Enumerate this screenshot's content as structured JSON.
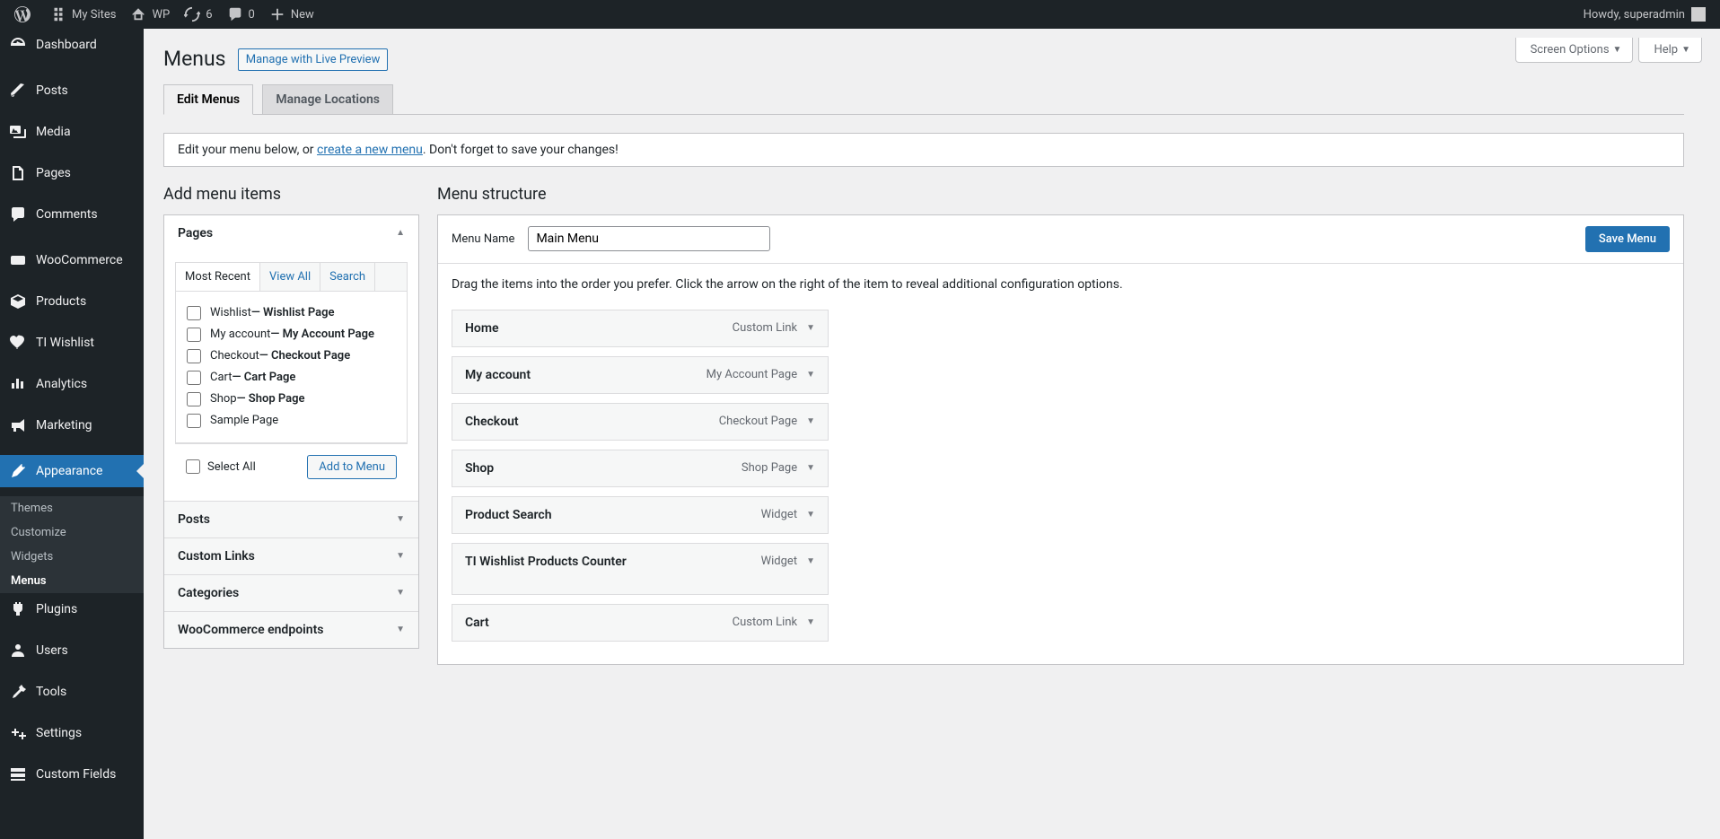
{
  "adminbar": {
    "mysites": "My Sites",
    "sitename": "WP",
    "updates": "6",
    "comments": "0",
    "new": "New",
    "howdy": "Howdy, superadmin"
  },
  "sidebar": {
    "items": [
      {
        "label": "Dashboard",
        "icon": "dashboard"
      },
      {
        "label": "Posts",
        "icon": "posts"
      },
      {
        "label": "Media",
        "icon": "media"
      },
      {
        "label": "Pages",
        "icon": "pages"
      },
      {
        "label": "Comments",
        "icon": "comments"
      },
      {
        "label": "WooCommerce",
        "icon": "woocommerce"
      },
      {
        "label": "Products",
        "icon": "products"
      },
      {
        "label": "TI Wishlist",
        "icon": "wishlist"
      },
      {
        "label": "Analytics",
        "icon": "analytics"
      },
      {
        "label": "Marketing",
        "icon": "marketing"
      },
      {
        "label": "Appearance",
        "icon": "appearance"
      },
      {
        "label": "Plugins",
        "icon": "plugins"
      },
      {
        "label": "Users",
        "icon": "users"
      },
      {
        "label": "Tools",
        "icon": "tools"
      },
      {
        "label": "Settings",
        "icon": "settings"
      },
      {
        "label": "Custom Fields",
        "icon": "customfields"
      }
    ],
    "appearance_submenu": [
      "Themes",
      "Customize",
      "Widgets",
      "Menus"
    ]
  },
  "screen_options": "Screen Options",
  "help": "Help",
  "heading": "Menus",
  "page_action": "Manage with Live Preview",
  "tabs": {
    "edit": "Edit Menus",
    "locations": "Manage Locations"
  },
  "notice": {
    "pre": "Edit your menu below, or ",
    "link": "create a new menu",
    "post": ". Don't forget to save your changes!"
  },
  "add_items_heading": "Add menu items",
  "menu_structure_heading": "Menu structure",
  "accordion": {
    "pages": {
      "title": "Pages",
      "tabs": [
        "Most Recent",
        "View All",
        "Search"
      ],
      "items": [
        {
          "label": "Wishlist ",
          "suffix": "— Wishlist Page"
        },
        {
          "label": "My account ",
          "suffix": "— My Account Page"
        },
        {
          "label": "Checkout ",
          "suffix": "— Checkout Page"
        },
        {
          "label": "Cart ",
          "suffix": "— Cart Page"
        },
        {
          "label": "Shop ",
          "suffix": "— Shop Page"
        },
        {
          "label": "Sample Page",
          "suffix": ""
        }
      ],
      "select_all": "Select All",
      "add_to_menu": "Add to Menu"
    },
    "posts": "Posts",
    "custom_links": "Custom Links",
    "categories": "Categories",
    "woo_endpoints": "WooCommerce endpoints"
  },
  "menu_name_label": "Menu Name",
  "menu_name_value": "Main Menu",
  "save_menu": "Save Menu",
  "drag_instructions": "Drag the items into the order you prefer. Click the arrow on the right of the item to reveal additional configuration options.",
  "menu_items": [
    {
      "title": "Home",
      "type": "Custom Link"
    },
    {
      "title": "My account",
      "type": "My Account Page"
    },
    {
      "title": "Checkout",
      "type": "Checkout Page"
    },
    {
      "title": "Shop",
      "type": "Shop Page"
    },
    {
      "title": "Product Search",
      "type": "Widget"
    },
    {
      "title": "TI Wishlist Products Counter",
      "type": "Widget"
    },
    {
      "title": "Cart",
      "type": "Custom Link"
    }
  ]
}
